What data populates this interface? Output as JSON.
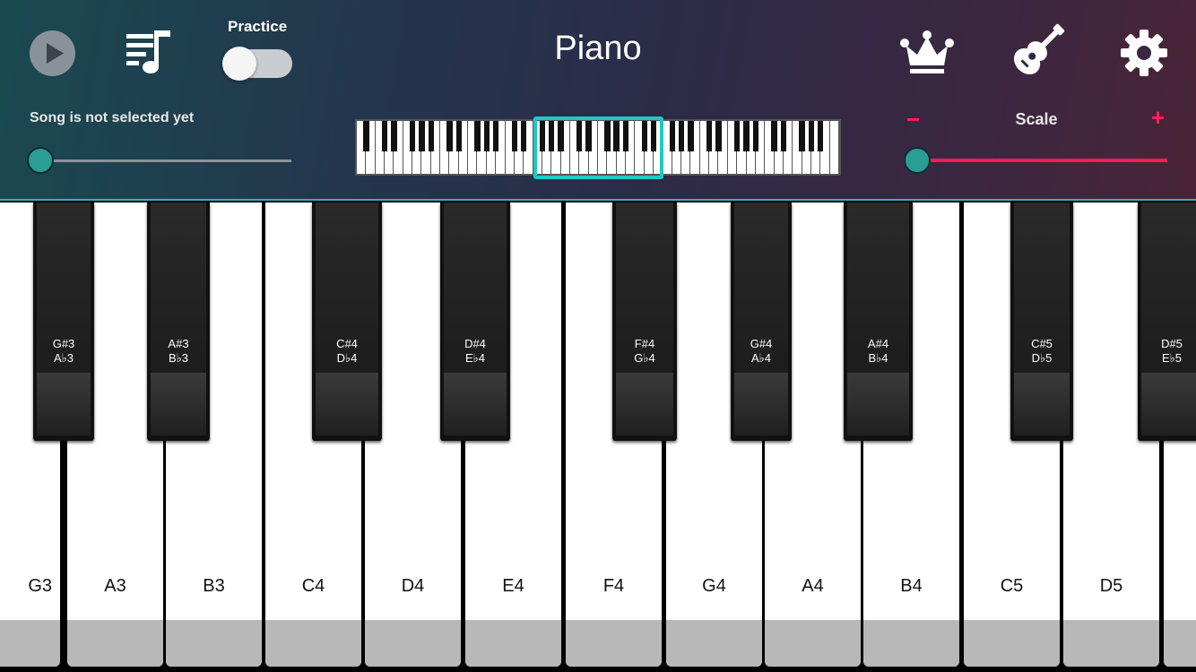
{
  "header": {
    "title": "Piano",
    "practice_label": "Practice",
    "practice_enabled": false,
    "song_status": "Song is not selected yet",
    "song_progress": 0,
    "scale_label": "Scale",
    "scale_minus": "−",
    "scale_plus": "+",
    "scale_value": 0,
    "colors": {
      "accent_teal": "#20c8c8",
      "accent_pink": "#ff1a5a"
    },
    "icons": [
      "play-icon",
      "playlist-icon",
      "crown-icon",
      "guitar-icon",
      "gear-icon"
    ]
  },
  "keyboard": {
    "white_keys": [
      "G3",
      "A3",
      "B3",
      "C4",
      "D4",
      "E4",
      "F4",
      "G4",
      "A4",
      "B4",
      "C5",
      "D5",
      ""
    ],
    "black_keys": [
      {
        "sharp": "G#3",
        "flat": "A♭3"
      },
      {
        "sharp": "A#3",
        "flat": "B♭3"
      },
      {
        "sharp": "C#4",
        "flat": "D♭4"
      },
      {
        "sharp": "D#4",
        "flat": "E♭4"
      },
      {
        "sharp": "F#4",
        "flat": "G♭4"
      },
      {
        "sharp": "G#4",
        "flat": "A♭4"
      },
      {
        "sharp": "A#4",
        "flat": "B♭4"
      },
      {
        "sharp": "C#5",
        "flat": "D♭5"
      },
      {
        "sharp": "D#5",
        "flat": "E♭5"
      }
    ]
  }
}
